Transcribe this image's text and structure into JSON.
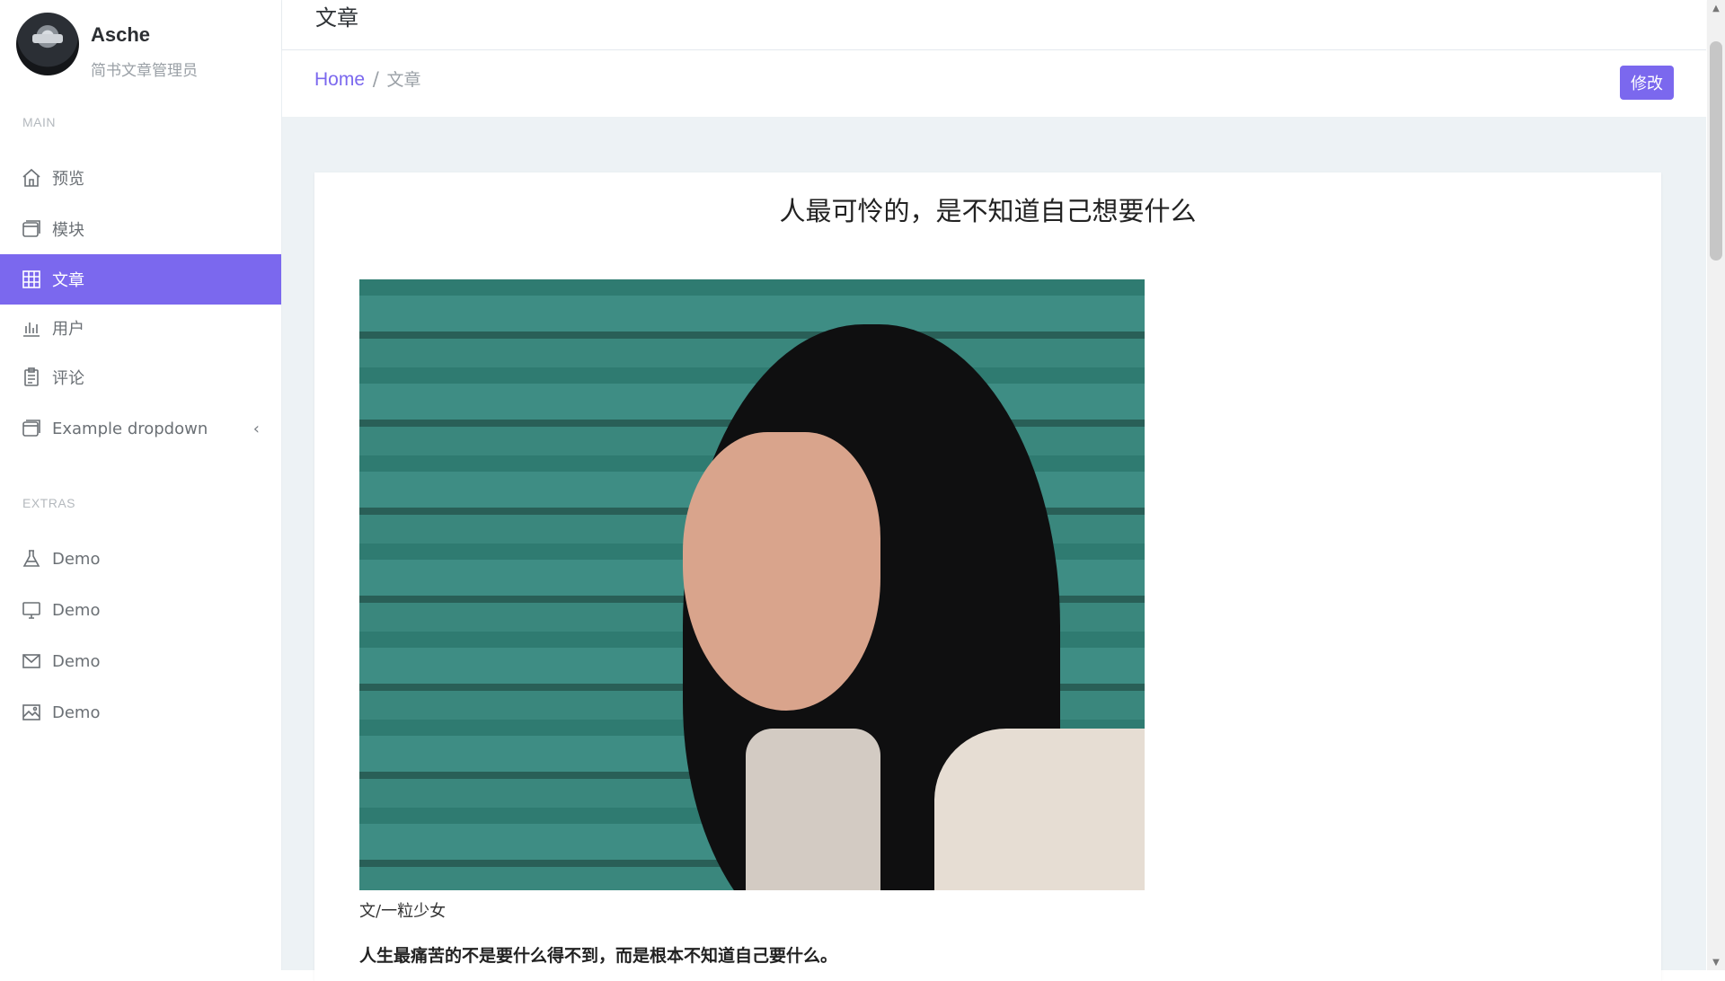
{
  "profile": {
    "name": "Asche",
    "role": "简书文章管理员"
  },
  "sidebar": {
    "main_label": "MAIN",
    "extras_label": "EXTRAS",
    "items": [
      {
        "label": "预览",
        "icon": "home-icon"
      },
      {
        "label": "模块",
        "icon": "browser-window-icon"
      },
      {
        "label": "文章",
        "icon": "grid-icon",
        "active": true
      },
      {
        "label": "用户",
        "icon": "bar-chart-icon"
      },
      {
        "label": "评论",
        "icon": "clipboard-icon"
      },
      {
        "label": "Example dropdown",
        "icon": "browser-window-icon",
        "caret": "‹"
      }
    ],
    "extras": [
      {
        "label": "Demo",
        "icon": "flask-icon"
      },
      {
        "label": "Demo",
        "icon": "monitor-icon"
      },
      {
        "label": "Demo",
        "icon": "mail-icon"
      },
      {
        "label": "Demo",
        "icon": "image-icon"
      }
    ]
  },
  "header": {
    "title": "文章"
  },
  "breadcrumb": {
    "home": "Home",
    "separator": "/",
    "current": "文章"
  },
  "actions": {
    "edit_label": "修改"
  },
  "article": {
    "title": "人最可怜的，是不知道自己想要什么",
    "caption": "文/一粒少女",
    "paragraph": "人生最痛苦的不是要什么得不到，而是根本不知道自己要什么。"
  },
  "colors": {
    "accent": "#7b68ee",
    "content_bg": "#edf2f5"
  }
}
